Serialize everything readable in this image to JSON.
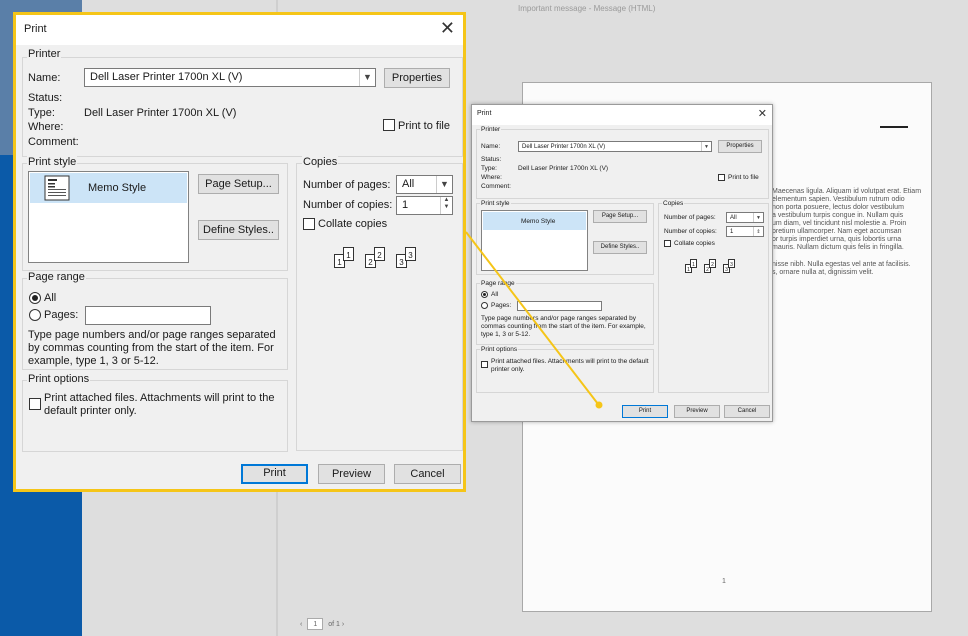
{
  "background": {
    "window_title": "Important message  -  Message (HTML)",
    "preview_lines": [
      "Maecenas ligula. Aliquam id volutpat erat. Etiam",
      "elementum sapien. Vestibulum rutrum odio",
      "non porta posuere, lectus dolor vestibulum",
      "a vestibulum turpis congue in. Nullam quis",
      "um diam, vel tincidunt nisl molestie a. Proin",
      "pretium ullamcorper. Nam eget accumsan",
      "or turpis imperdiet urna, quis lobortis urna",
      "mauris. Nullam dictum quis felis in fringilla.",
      "",
      "nisse nibh. Nulla egestas vel ante at facilisis.",
      "s, ornare nulla at, dignissim velit."
    ],
    "page_number": "1",
    "page_nav": {
      "prev": "‹",
      "current": "1",
      "of": "of 1",
      "next": "›"
    }
  },
  "print_dialog": {
    "title": "Print",
    "close": "✕",
    "printer": {
      "group": "Printer",
      "name_label": "Name:",
      "name_value": "Dell Laser Printer 1700n XL (V)",
      "properties_button": "Properties",
      "status_label": "Status:",
      "status_value": "",
      "type_label": "Type:",
      "type_value": "Dell Laser Printer 1700n XL (V)",
      "where_label": "Where:",
      "comment_label": "Comment:",
      "print_to_file": "Print to file"
    },
    "print_style": {
      "group": "Print style",
      "selected": "Memo Style",
      "page_setup_button": "Page Setup...",
      "define_styles_button": "Define Styles.."
    },
    "copies": {
      "group": "Copies",
      "pages_label": "Number of pages:",
      "pages_value": "All",
      "copies_label": "Number of copies:",
      "copies_value": "1",
      "collate_label": "Collate copies",
      "icon_numbers": [
        "1",
        "1",
        "2",
        "2",
        "3",
        "3"
      ]
    },
    "page_range": {
      "group": "Page range",
      "all_label": "All",
      "pages_label": "Pages:",
      "note": "Type page numbers and/or page ranges separated by commas counting from the start of the item.  For example, type 1, 3 or 5-12."
    },
    "print_options": {
      "group": "Print options",
      "attached_files": "Print attached files.  Attachments will print to the default printer only."
    },
    "buttons": {
      "print": "Print",
      "preview": "Preview",
      "cancel": "Cancel"
    }
  },
  "colors": {
    "highlight_border": "#f5c518",
    "accent": "#0078d7",
    "selection": "#cce4f7"
  }
}
